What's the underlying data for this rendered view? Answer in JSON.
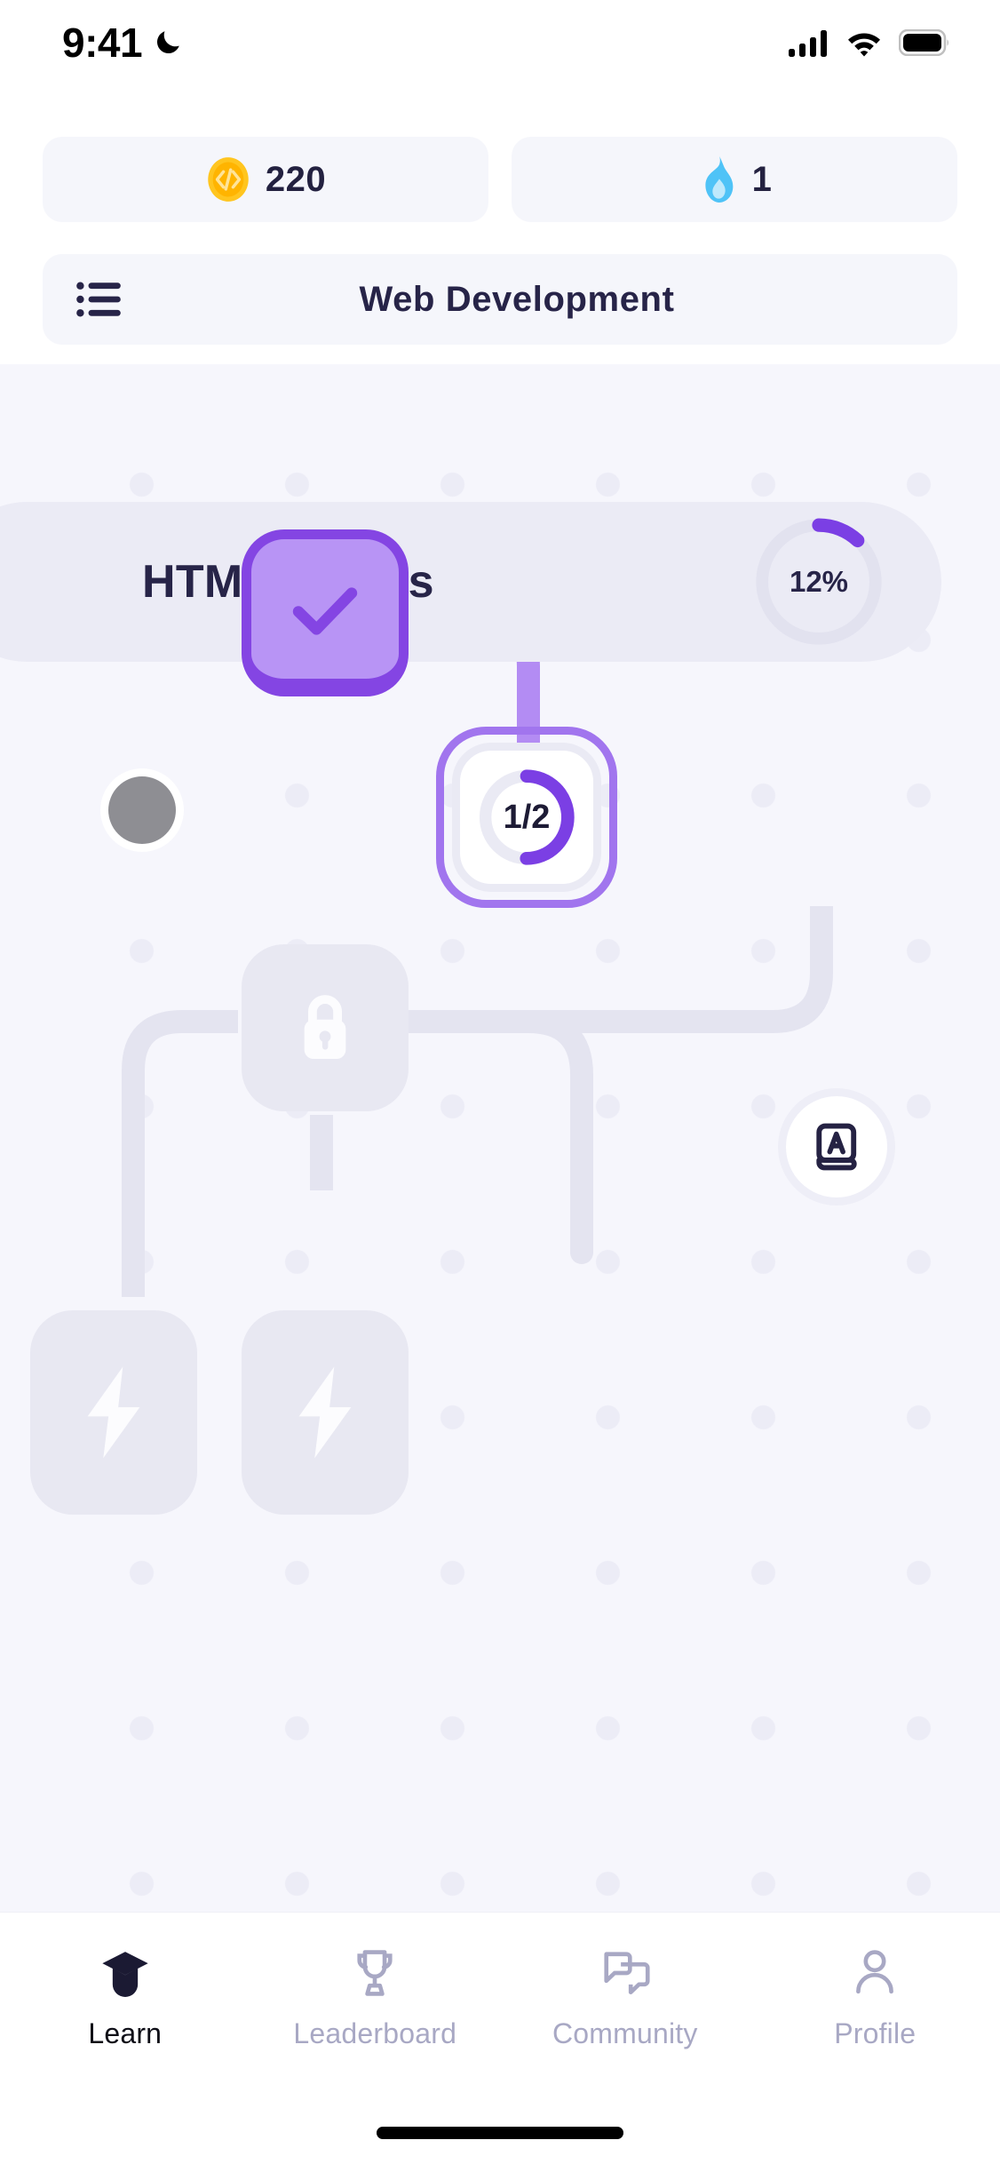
{
  "status_bar": {
    "time": "9:41",
    "dnd_icon": "crescent-moon-icon",
    "cellular_icon": "cellular-signal-icon",
    "wifi_icon": "wifi-icon",
    "battery_icon": "battery-full-icon"
  },
  "stats": {
    "coins": {
      "icon": "coin-code-icon",
      "value": "220",
      "color": "#FFC020"
    },
    "streak": {
      "icon": "flame-icon",
      "value": "1",
      "color": "#4FC3F7"
    }
  },
  "course_header": {
    "menu_icon": "list-menu-icon",
    "title": "Web Development"
  },
  "unit": {
    "title": "HTML Basics",
    "progress_percent": "12%",
    "progress_value": 12,
    "ring_color": "#7B3FE4",
    "ring_track_color": "#E2E2EF",
    "banner_color": "#EBEBF5"
  },
  "path": {
    "nodes": [
      {
        "id": "lesson-1",
        "state": "completed",
        "icon": "check-icon",
        "label": "",
        "fill": "#B894F5",
        "border": "#8445E3"
      },
      {
        "id": "lesson-2",
        "state": "current",
        "icon": "progress-ring-icon",
        "label": "1/2",
        "progress_value": 50,
        "ring_color": "#7B3FE4",
        "outline": "#A175EE"
      },
      {
        "id": "lesson-3",
        "state": "locked",
        "icon": "lock-icon",
        "label": "",
        "fill": "#E8E8F2"
      },
      {
        "id": "lesson-4",
        "state": "locked",
        "icon": "lightning-bolt-icon",
        "label": "",
        "fill": "#E8E8F2"
      },
      {
        "id": "lesson-5",
        "state": "locked",
        "icon": "lightning-bolt-icon",
        "label": "",
        "fill": "#E8E8F2"
      }
    ],
    "connector_active_color": "#B38CF3",
    "connector_locked_color": "#E4E4F0",
    "glossary_button": {
      "icon": "book-letter-a-icon",
      "label": ""
    },
    "touch_indicator": {
      "icon": "touch-point-icon",
      "color": "#8E8E93"
    }
  },
  "tabbar": {
    "items": [
      {
        "id": "learn",
        "label": "Learn",
        "icon": "graduation-cap-icon",
        "active": true
      },
      {
        "id": "leaderboard",
        "label": "Leaderboard",
        "icon": "trophy-icon",
        "active": false
      },
      {
        "id": "community",
        "label": "Community",
        "icon": "chat-bubbles-icon",
        "active": false
      },
      {
        "id": "profile",
        "label": "Profile",
        "icon": "person-icon",
        "active": false
      }
    ],
    "active_color": "#1B1A33",
    "inactive_color": "#A8A8C4"
  },
  "home_indicator": "home-indicator"
}
